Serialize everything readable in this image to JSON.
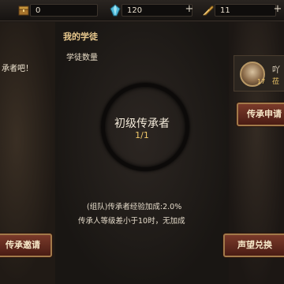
{
  "topbar": {
    "resources": [
      {
        "icon": "treasure-chest-icon",
        "value": "0",
        "color": "#c8963c"
      },
      {
        "icon": "blue-crystal-icon",
        "value": "120",
        "color": "#4fb8d8"
      },
      {
        "icon": "gold-feather-icon",
        "value": "11",
        "color": "#d8a040"
      }
    ],
    "plus_symbol": "+"
  },
  "left": {
    "invite_text": "承者吧！",
    "invite_button": "传承邀请"
  },
  "center": {
    "title": "我的学徒",
    "subtitle": "学徒数量",
    "rank_title": "初级传承者",
    "count": "1/1",
    "info_line1": "(组队)传承者经验加成:2.0%",
    "info_line2": "传承人等级差小于10时，无加成"
  },
  "right": {
    "player_name": "吖",
    "player_sub": "莅",
    "player_level": "17",
    "apply_button": "传承申请",
    "exchange_button": "声望兑换"
  }
}
